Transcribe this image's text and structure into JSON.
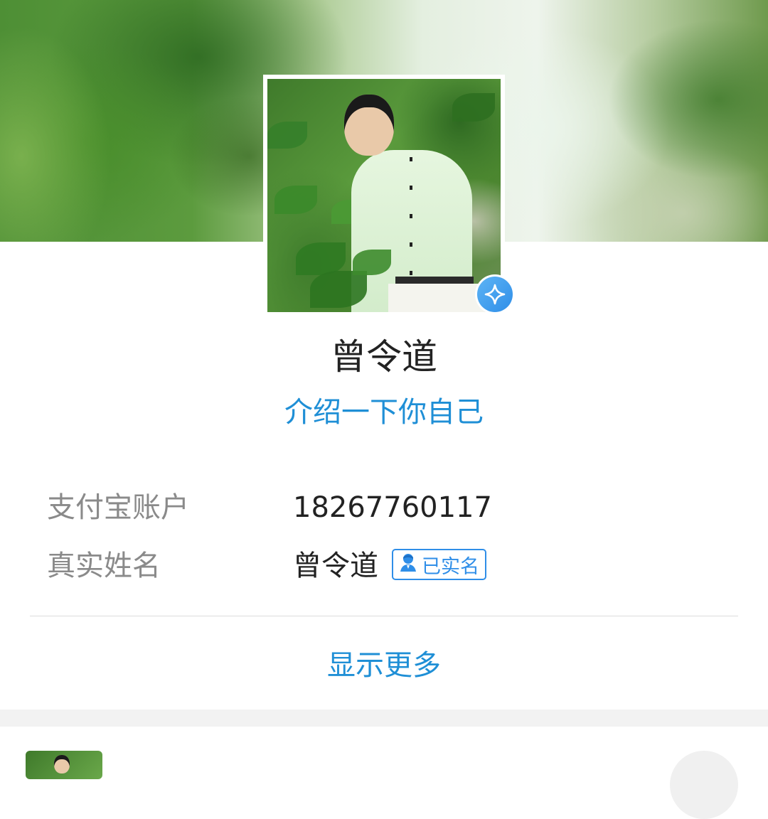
{
  "profile": {
    "name": "曾令道",
    "intro_link": "介绍一下你自己",
    "vip_icon": "sparkle-star-icon"
  },
  "info": {
    "rows": [
      {
        "label": "支付宝账户",
        "value": "18267760117"
      },
      {
        "label": "真实姓名",
        "value": "曾令道",
        "verified_badge": "已实名"
      }
    ]
  },
  "actions": {
    "show_more": "显示更多"
  },
  "colors": {
    "accent": "#1f8fd6",
    "label": "#8a8a8a",
    "text": "#222222",
    "badge_blue": "#2f8ee8"
  }
}
